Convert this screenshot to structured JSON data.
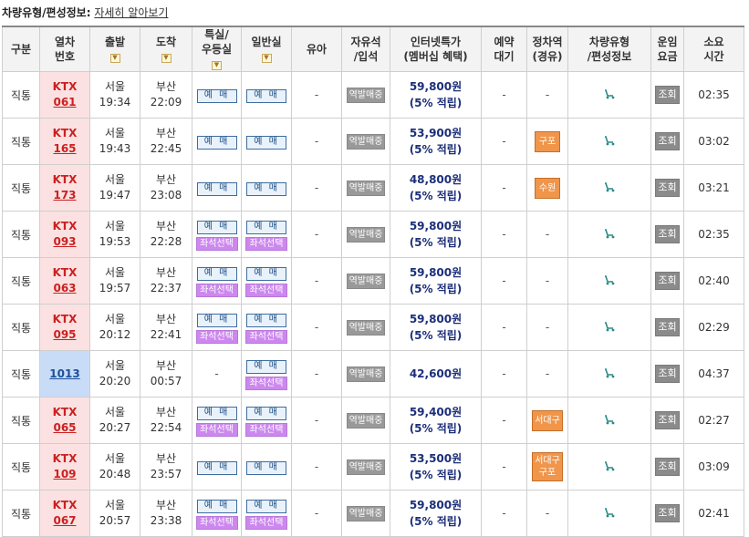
{
  "top": {
    "label": "차량유형/편성정보:",
    "link": "자세히 알아보기"
  },
  "headers": {
    "category": "구분",
    "train_no_1": "열차",
    "train_no_2": "번호",
    "depart": "출발",
    "arrive": "도착",
    "special_1": "특실/",
    "special_2": "우등실",
    "general": "일반실",
    "infant": "유아",
    "free_1": "자유석",
    "free_2": "/입석",
    "internet_1": "인터넷특가",
    "internet_2": "(멤버십 혜택)",
    "waitlist_1": "예약",
    "waitlist_2": "대기",
    "via_1": "정차역",
    "via_2": "(경유)",
    "cartype_1": "차량유형",
    "cartype_2": "/편성정보",
    "fare_1": "운임",
    "fare_2": "요금",
    "duration_1": "소요",
    "duration_2": "시간",
    "sort_icon": "▼"
  },
  "labels": {
    "reserve": "예 매",
    "seat_select": "좌석선택",
    "station_sale": "역발매중",
    "fare_query": "조회",
    "dash": "-"
  },
  "icons": {
    "sort": "sort-arrow-icon",
    "car": "train-car-icon"
  },
  "colors": {
    "ktx_cell": "#fbe1e1",
    "mugunghwa_cell": "#c8dcf7",
    "price_text": "#1c2f7a",
    "seat_button": "#cc88ee",
    "transfer_badge": "#f0954a"
  },
  "rows": [
    {
      "category": "직통",
      "type": "KTX",
      "number": "061",
      "dep_station": "서울",
      "dep_time": "19:34",
      "arr_station": "부산",
      "arr_time": "22:09",
      "price": "59,800원",
      "points": "(5% 적립)",
      "via": [],
      "duration": "02:35"
    },
    {
      "category": "직통",
      "type": "KTX",
      "number": "165",
      "dep_station": "서울",
      "dep_time": "19:43",
      "arr_station": "부산",
      "arr_time": "22:45",
      "price": "53,900원",
      "points": "(5% 적립)",
      "via": [
        "구포"
      ],
      "duration": "03:02"
    },
    {
      "category": "직통",
      "type": "KTX",
      "number": "173",
      "dep_station": "서울",
      "dep_time": "19:47",
      "arr_station": "부산",
      "arr_time": "23:08",
      "price": "48,800원",
      "points": "(5% 적립)",
      "via": [
        "수원"
      ],
      "duration": "03:21"
    },
    {
      "category": "직통",
      "type": "KTX",
      "number": "093",
      "dep_station": "서울",
      "dep_time": "19:53",
      "arr_station": "부산",
      "arr_time": "22:28",
      "price": "59,800원",
      "points": "(5% 적립)",
      "via": [],
      "duration": "02:35"
    },
    {
      "category": "직통",
      "type": "KTX",
      "number": "063",
      "dep_station": "서울",
      "dep_time": "19:57",
      "arr_station": "부산",
      "arr_time": "22:37",
      "price": "59,800원",
      "points": "(5% 적립)",
      "via": [],
      "duration": "02:40"
    },
    {
      "category": "직통",
      "type": "KTX",
      "number": "095",
      "dep_station": "서울",
      "dep_time": "20:12",
      "arr_station": "부산",
      "arr_time": "22:41",
      "price": "59,800원",
      "points": "(5% 적립)",
      "via": [],
      "duration": "02:29"
    },
    {
      "category": "직통",
      "type": "",
      "number": "1013",
      "dep_station": "서울",
      "dep_time": "20:20",
      "arr_station": "부산",
      "arr_time": "00:57",
      "price": "42,600원",
      "points": "",
      "via": [],
      "duration": "04:37"
    },
    {
      "category": "직통",
      "type": "KTX",
      "number": "065",
      "dep_station": "서울",
      "dep_time": "20:27",
      "arr_station": "부산",
      "arr_time": "22:54",
      "price": "59,400원",
      "points": "(5% 적립)",
      "via": [
        "서대구"
      ],
      "duration": "02:27"
    },
    {
      "category": "직통",
      "type": "KTX",
      "number": "109",
      "dep_station": "서울",
      "dep_time": "20:48",
      "arr_station": "부산",
      "arr_time": "23:57",
      "price": "53,500원",
      "points": "(5% 적립)",
      "via": [
        "서대구",
        "구포"
      ],
      "duration": "03:09"
    },
    {
      "category": "직통",
      "type": "KTX",
      "number": "067",
      "dep_station": "서울",
      "dep_time": "20:57",
      "arr_station": "부산",
      "arr_time": "23:38",
      "price": "59,800원",
      "points": "(5% 적립)",
      "via": [],
      "duration": "02:41"
    }
  ]
}
